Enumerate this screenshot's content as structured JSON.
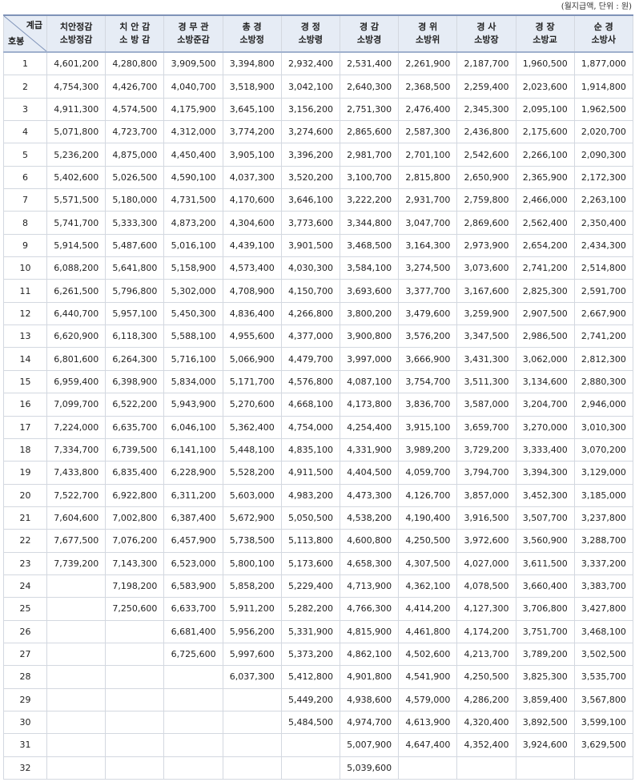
{
  "note": "(월지급액, 단위 : 원)",
  "corner": {
    "grade_label": "계급",
    "step_label": "호봉"
  },
  "columns": [
    {
      "line1": "치안정감",
      "line2": "소방정감"
    },
    {
      "line1": "치 안 감",
      "line2": "소 방 감"
    },
    {
      "line1": "경 무 관",
      "line2": "소방준감"
    },
    {
      "line1": "총 경",
      "line2": "소방정"
    },
    {
      "line1": "경 정",
      "line2": "소방령"
    },
    {
      "line1": "경 감",
      "line2": "소방경"
    },
    {
      "line1": "경 위",
      "line2": "소방위"
    },
    {
      "line1": "경 사",
      "line2": "소방장"
    },
    {
      "line1": "경 장",
      "line2": "소방교"
    },
    {
      "line1": "순 경",
      "line2": "소방사"
    }
  ],
  "rows": [
    {
      "step": "1",
      "values": [
        "4,601,200",
        "4,280,800",
        "3,909,500",
        "3,394,800",
        "2,932,400",
        "2,531,400",
        "2,261,900",
        "2,187,700",
        "1,960,500",
        "1,877,000"
      ]
    },
    {
      "step": "2",
      "values": [
        "4,754,300",
        "4,426,700",
        "4,040,700",
        "3,518,900",
        "3,042,100",
        "2,640,300",
        "2,368,500",
        "2,259,400",
        "2,023,600",
        "1,914,800"
      ]
    },
    {
      "step": "3",
      "values": [
        "4,911,300",
        "4,574,500",
        "4,175,900",
        "3,645,100",
        "3,156,200",
        "2,751,300",
        "2,476,400",
        "2,345,300",
        "2,095,100",
        "1,962,500"
      ]
    },
    {
      "step": "4",
      "values": [
        "5,071,800",
        "4,723,700",
        "4,312,000",
        "3,774,200",
        "3,274,600",
        "2,865,600",
        "2,587,300",
        "2,436,800",
        "2,175,600",
        "2,020,700"
      ]
    },
    {
      "step": "5",
      "values": [
        "5,236,200",
        "4,875,000",
        "4,450,400",
        "3,905,100",
        "3,396,200",
        "2,981,700",
        "2,701,100",
        "2,542,600",
        "2,266,100",
        "2,090,300"
      ]
    },
    {
      "step": "6",
      "values": [
        "5,402,600",
        "5,026,500",
        "4,590,100",
        "4,037,300",
        "3,520,200",
        "3,100,700",
        "2,815,800",
        "2,650,900",
        "2,365,900",
        "2,172,300"
      ]
    },
    {
      "step": "7",
      "values": [
        "5,571,500",
        "5,180,000",
        "4,731,500",
        "4,170,600",
        "3,646,100",
        "3,222,200",
        "2,931,700",
        "2,759,800",
        "2,466,000",
        "2,263,100"
      ]
    },
    {
      "step": "8",
      "values": [
        "5,741,700",
        "5,333,300",
        "4,873,200",
        "4,304,600",
        "3,773,600",
        "3,344,800",
        "3,047,700",
        "2,869,600",
        "2,562,400",
        "2,350,400"
      ]
    },
    {
      "step": "9",
      "values": [
        "5,914,500",
        "5,487,600",
        "5,016,100",
        "4,439,100",
        "3,901,500",
        "3,468,500",
        "3,164,300",
        "2,973,900",
        "2,654,200",
        "2,434,300"
      ]
    },
    {
      "step": "10",
      "values": [
        "6,088,200",
        "5,641,800",
        "5,158,900",
        "4,573,400",
        "4,030,300",
        "3,584,100",
        "3,274,500",
        "3,073,600",
        "2,741,200",
        "2,514,800"
      ]
    },
    {
      "step": "11",
      "values": [
        "6,261,500",
        "5,796,800",
        "5,302,000",
        "4,708,900",
        "4,150,700",
        "3,693,600",
        "3,377,700",
        "3,167,600",
        "2,825,300",
        "2,591,700"
      ]
    },
    {
      "step": "12",
      "values": [
        "6,440,700",
        "5,957,100",
        "5,450,300",
        "4,836,400",
        "4,266,800",
        "3,800,200",
        "3,479,600",
        "3,259,900",
        "2,907,500",
        "2,667,900"
      ]
    },
    {
      "step": "13",
      "values": [
        "6,620,900",
        "6,118,300",
        "5,588,100",
        "4,955,600",
        "4,377,000",
        "3,900,800",
        "3,576,200",
        "3,347,500",
        "2,986,500",
        "2,741,200"
      ]
    },
    {
      "step": "14",
      "values": [
        "6,801,600",
        "6,264,300",
        "5,716,100",
        "5,066,900",
        "4,479,700",
        "3,997,000",
        "3,666,900",
        "3,431,300",
        "3,062,000",
        "2,812,300"
      ]
    },
    {
      "step": "15",
      "values": [
        "6,959,400",
        "6,398,900",
        "5,834,000",
        "5,171,700",
        "4,576,800",
        "4,087,100",
        "3,754,700",
        "3,511,300",
        "3,134,600",
        "2,880,300"
      ]
    },
    {
      "step": "16",
      "values": [
        "7,099,700",
        "6,522,200",
        "5,943,900",
        "5,270,600",
        "4,668,100",
        "4,173,800",
        "3,836,700",
        "3,587,000",
        "3,204,700",
        "2,946,000"
      ]
    },
    {
      "step": "17",
      "values": [
        "7,224,000",
        "6,635,700",
        "6,046,100",
        "5,362,400",
        "4,754,000",
        "4,254,400",
        "3,915,100",
        "3,659,700",
        "3,270,000",
        "3,010,300"
      ]
    },
    {
      "step": "18",
      "values": [
        "7,334,700",
        "6,739,500",
        "6,141,100",
        "5,448,100",
        "4,835,100",
        "4,331,900",
        "3,989,200",
        "3,729,200",
        "3,333,400",
        "3,070,200"
      ]
    },
    {
      "step": "19",
      "values": [
        "7,433,800",
        "6,835,400",
        "6,228,900",
        "5,528,200",
        "4,911,500",
        "4,404,500",
        "4,059,700",
        "3,794,700",
        "3,394,300",
        "3,129,000"
      ]
    },
    {
      "step": "20",
      "values": [
        "7,522,700",
        "6,922,800",
        "6,311,200",
        "5,603,000",
        "4,983,200",
        "4,473,300",
        "4,126,700",
        "3,857,000",
        "3,452,300",
        "3,185,000"
      ]
    },
    {
      "step": "21",
      "values": [
        "7,604,600",
        "7,002,800",
        "6,387,400",
        "5,672,900",
        "5,050,500",
        "4,538,200",
        "4,190,400",
        "3,916,500",
        "3,507,700",
        "3,237,800"
      ]
    },
    {
      "step": "22",
      "values": [
        "7,677,500",
        "7,076,200",
        "6,457,900",
        "5,738,500",
        "5,113,800",
        "4,600,800",
        "4,250,500",
        "3,972,600",
        "3,560,900",
        "3,288,700"
      ]
    },
    {
      "step": "23",
      "values": [
        "7,739,200",
        "7,143,300",
        "6,523,000",
        "5,800,100",
        "5,173,600",
        "4,658,300",
        "4,307,500",
        "4,027,000",
        "3,611,500",
        "3,337,200"
      ]
    },
    {
      "step": "24",
      "values": [
        "",
        "7,198,200",
        "6,583,900",
        "5,858,200",
        "5,229,400",
        "4,713,900",
        "4,362,100",
        "4,078,500",
        "3,660,400",
        "3,383,700"
      ]
    },
    {
      "step": "25",
      "values": [
        "",
        "7,250,600",
        "6,633,700",
        "5,911,200",
        "5,282,200",
        "4,766,300",
        "4,414,200",
        "4,127,300",
        "3,706,800",
        "3,427,800"
      ]
    },
    {
      "step": "26",
      "values": [
        "",
        "",
        "6,681,400",
        "5,956,200",
        "5,331,900",
        "4,815,900",
        "4,461,800",
        "4,174,200",
        "3,751,700",
        "3,468,100"
      ]
    },
    {
      "step": "27",
      "values": [
        "",
        "",
        "6,725,600",
        "5,997,600",
        "5,373,200",
        "4,862,100",
        "4,502,600",
        "4,213,700",
        "3,789,200",
        "3,502,500"
      ]
    },
    {
      "step": "28",
      "values": [
        "",
        "",
        "",
        "6,037,300",
        "5,412,800",
        "4,901,800",
        "4,541,900",
        "4,250,500",
        "3,825,300",
        "3,535,700"
      ]
    },
    {
      "step": "29",
      "values": [
        "",
        "",
        "",
        "",
        "5,449,200",
        "4,938,600",
        "4,579,000",
        "4,286,200",
        "3,859,400",
        "3,567,800"
      ]
    },
    {
      "step": "30",
      "values": [
        "",
        "",
        "",
        "",
        "5,484,500",
        "4,974,700",
        "4,613,900",
        "4,320,400",
        "3,892,500",
        "3,599,100"
      ]
    },
    {
      "step": "31",
      "values": [
        "",
        "",
        "",
        "",
        "",
        "5,007,900",
        "4,647,400",
        "4,352,400",
        "3,924,600",
        "3,629,500"
      ]
    },
    {
      "step": "32",
      "values": [
        "",
        "",
        "",
        "",
        "",
        "5,039,600",
        "",
        "",
        "",
        ""
      ]
    }
  ]
}
